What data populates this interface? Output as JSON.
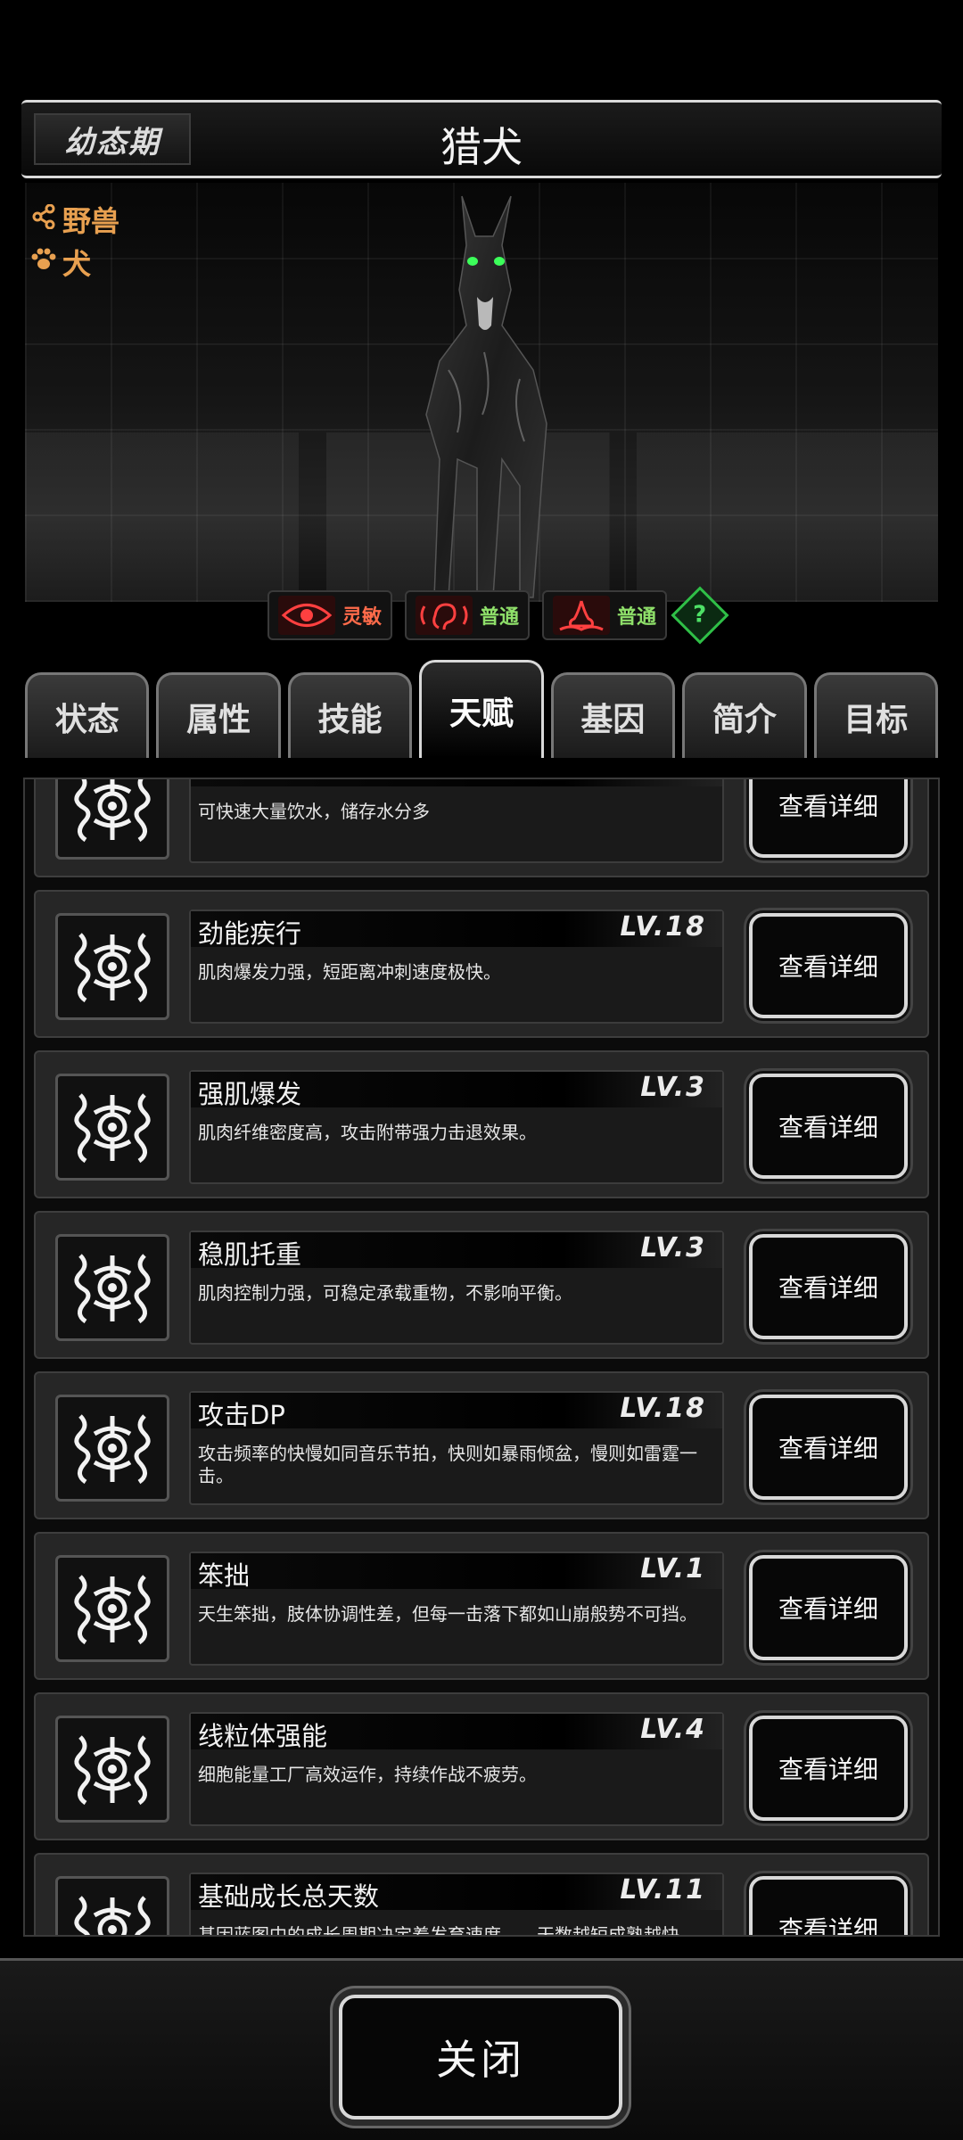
{
  "header": {
    "stage": "幼态期",
    "title": "猎犬"
  },
  "creature": {
    "tags": [
      {
        "icon": "share-icon",
        "text": "野兽"
      },
      {
        "icon": "paw-icon",
        "text": "犬"
      }
    ],
    "senses": [
      {
        "icon": "eye-icon",
        "label": "灵敏",
        "color": "#ff6b4a"
      },
      {
        "icon": "ear-icon",
        "label": "普通",
        "color": "#8fe06a"
      },
      {
        "icon": "nose-icon",
        "label": "普通",
        "color": "#8fe06a"
      }
    ],
    "help_icon": "question-icon"
  },
  "tabs": [
    "状态",
    "属性",
    "技能",
    "天赋",
    "基因",
    "简介",
    "目标"
  ],
  "active_tab": "天赋",
  "talents": [
    {
      "name": "",
      "level": "",
      "desc": "可快速大量饮水，储存水分多",
      "button": "查看详细"
    },
    {
      "name": "劲能疾行",
      "level": "LV.18",
      "desc": "肌肉爆发力强，短距离冲刺速度极快。",
      "button": "查看详细"
    },
    {
      "name": "强肌爆发",
      "level": "LV.3",
      "desc": "肌肉纤维密度高，攻击附带强力击退效果。",
      "button": "查看详细"
    },
    {
      "name": "稳肌托重",
      "level": "LV.3",
      "desc": "肌肉控制力强，可稳定承载重物，不影响平衡。",
      "button": "查看详细"
    },
    {
      "name": "攻击DP",
      "level": "LV.18",
      "desc": "攻击频率的快慢如同音乐节拍，快则如暴雨倾盆，慢则如雷霆一击。",
      "button": "查看详细"
    },
    {
      "name": "笨拙",
      "level": "LV.1",
      "desc": "天生笨拙，肢体协调性差，但每一击落下都如山崩般势不可挡。",
      "button": "查看详细"
    },
    {
      "name": "线粒体强能",
      "level": "LV.4",
      "desc": "细胞能量工厂高效运作，持续作战不疲劳。",
      "button": "查看详细"
    },
    {
      "name": "基础成长总天数",
      "level": "LV.11",
      "desc": "基因蓝图中的成长周期决定着发育速度——天数越短成熟越快，越长则积累越深",
      "button": "查看详细"
    }
  ],
  "footer": {
    "close": "关闭"
  }
}
